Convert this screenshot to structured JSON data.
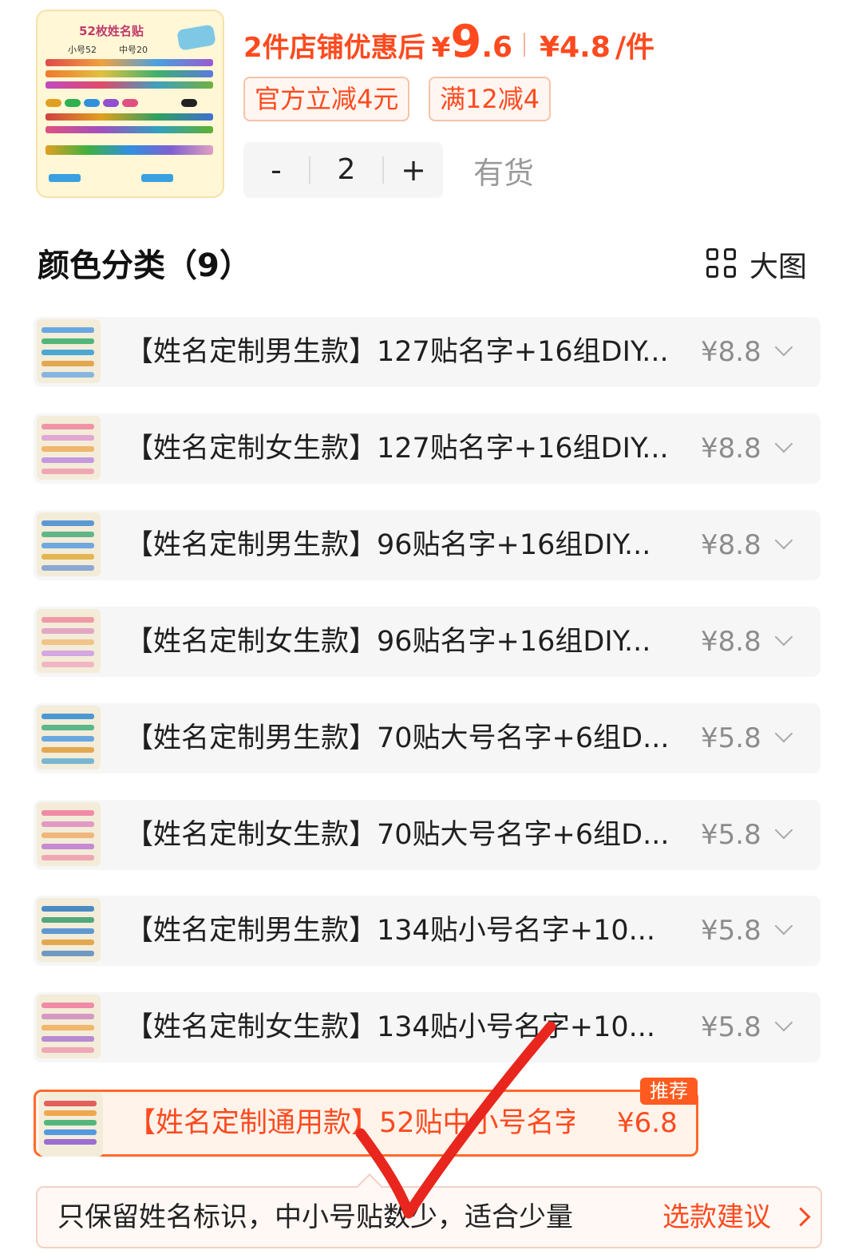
{
  "product": {
    "thumb_title": "52枚姓名贴",
    "thumb_small": "小号52",
    "thumb_mid": "中号20",
    "promo_label": "2件店铺优惠后",
    "currency": "¥",
    "promo_price_int": "9",
    "promo_price_dec": ".6",
    "unit_price": "¥4.8",
    "unit_suffix": "/件",
    "coupons": [
      "官方立减4元",
      "满12减4"
    ],
    "qty_minus": "-",
    "quantity": "2",
    "qty_plus": "+",
    "stock_status": "有货"
  },
  "section": {
    "title": "颜色分类（9）",
    "view_toggle_label": "大图"
  },
  "variants": [
    {
      "name": "【姓名定制男生款】127贴名字+16组DIY...",
      "price": "¥8.8"
    },
    {
      "name": "【姓名定制女生款】127贴名字+16组DIY...",
      "price": "¥8.8"
    },
    {
      "name": "【姓名定制男生款】96贴名字+16组DIY...",
      "price": "¥8.8"
    },
    {
      "name": "【姓名定制女生款】96贴名字+16组DIY...",
      "price": "¥8.8"
    },
    {
      "name": "【姓名定制男生款】70贴大号名字+6组D...",
      "price": "¥5.8"
    },
    {
      "name": "【姓名定制女生款】70贴大号名字+6组D...",
      "price": "¥5.8"
    },
    {
      "name": "【姓名定制男生款】134贴小号名字+10...",
      "price": "¥5.8"
    },
    {
      "name": "【姓名定制女生款】134贴小号名字+10...",
      "price": "¥5.8"
    }
  ],
  "selected_variant": {
    "name": "【姓名定制通用款】52贴中小号名字",
    "price": "¥6.8",
    "badge": "推荐"
  },
  "tip": {
    "text": "只保留姓名标识，中小号贴数少，适合少量",
    "advice_label": "选款建议"
  },
  "colors": {
    "accent": "#ff4a1f",
    "check_mark": "#e8261d"
  }
}
